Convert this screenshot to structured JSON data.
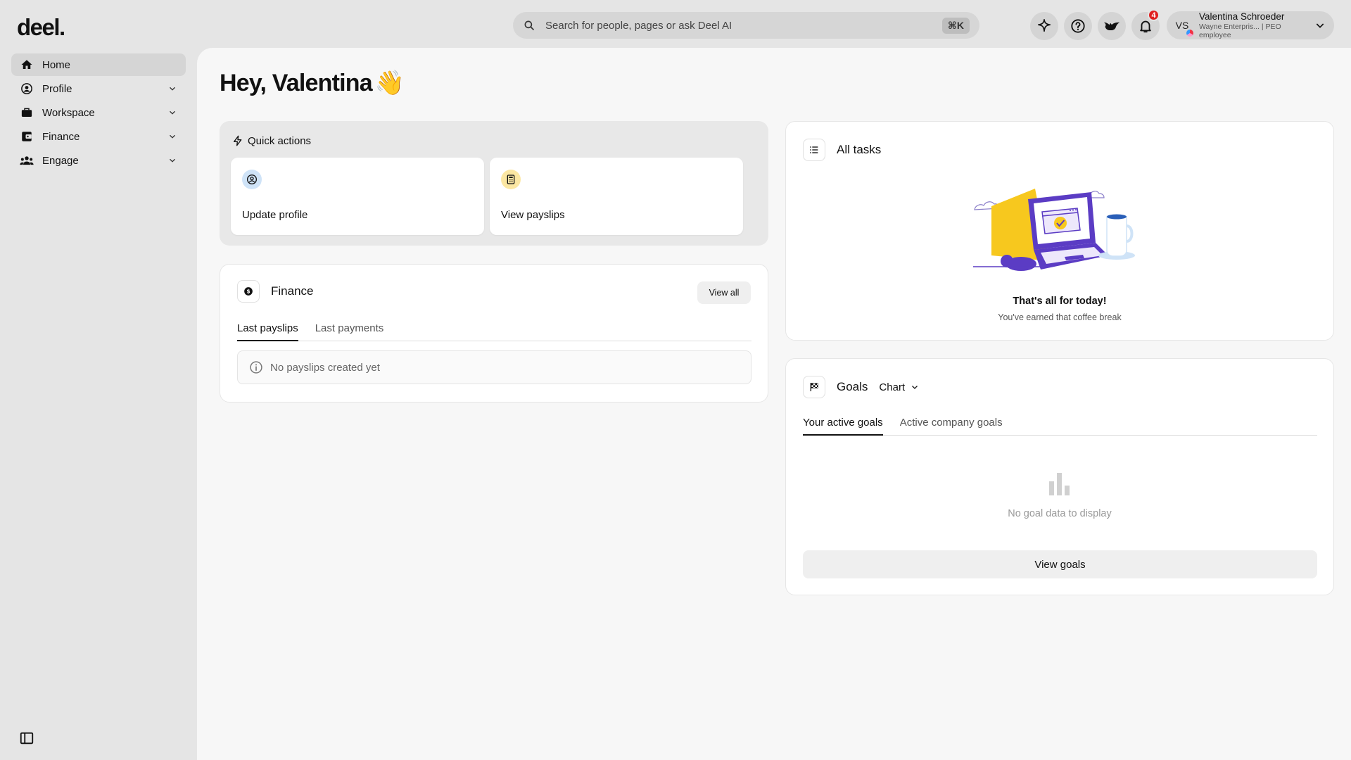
{
  "app": {
    "logo": "deel."
  },
  "sidebar": {
    "items": [
      {
        "label": "Home",
        "icon": "home-icon",
        "active": true
      },
      {
        "label": "Profile",
        "icon": "user-circle-icon"
      },
      {
        "label": "Workspace",
        "icon": "briefcase-icon"
      },
      {
        "label": "Finance",
        "icon": "wallet-icon"
      },
      {
        "label": "Engage",
        "icon": "people-icon"
      }
    ]
  },
  "search": {
    "placeholder": "Search for people, pages or ask Deel AI",
    "shortcut": "⌘K"
  },
  "topbar": {
    "notifications_count": "4"
  },
  "user": {
    "initials": "VS",
    "name": "Valentina Schroeder",
    "subtitle": "Wayne Enterpris... | PEO employee"
  },
  "greeting": {
    "text": "Hey, Valentina",
    "emoji": "👋"
  },
  "quick_actions": {
    "title": "Quick actions",
    "cards": [
      {
        "label": "Update profile",
        "icon": "user-circle-icon",
        "color": "#cfe3f7"
      },
      {
        "label": "View payslips",
        "icon": "calculator-icon",
        "color": "#fbe7a3"
      }
    ]
  },
  "finance": {
    "title": "Finance",
    "view_all": "View all",
    "tabs": [
      "Last payslips",
      "Last payments"
    ],
    "empty": "No payslips created yet"
  },
  "tasks": {
    "title": "All tasks",
    "message": "That's all for today!",
    "sub": "You've earned that coffee break"
  },
  "goals": {
    "title": "Goals",
    "view_mode": "Chart",
    "tabs": [
      "Your active goals",
      "Active company goals"
    ],
    "empty": "No goal data to display",
    "button": "View goals"
  },
  "colors": {
    "accent_purple": "#5b3cc4",
    "accent_yellow": "#f7c81e",
    "badge_red": "#e02020"
  }
}
